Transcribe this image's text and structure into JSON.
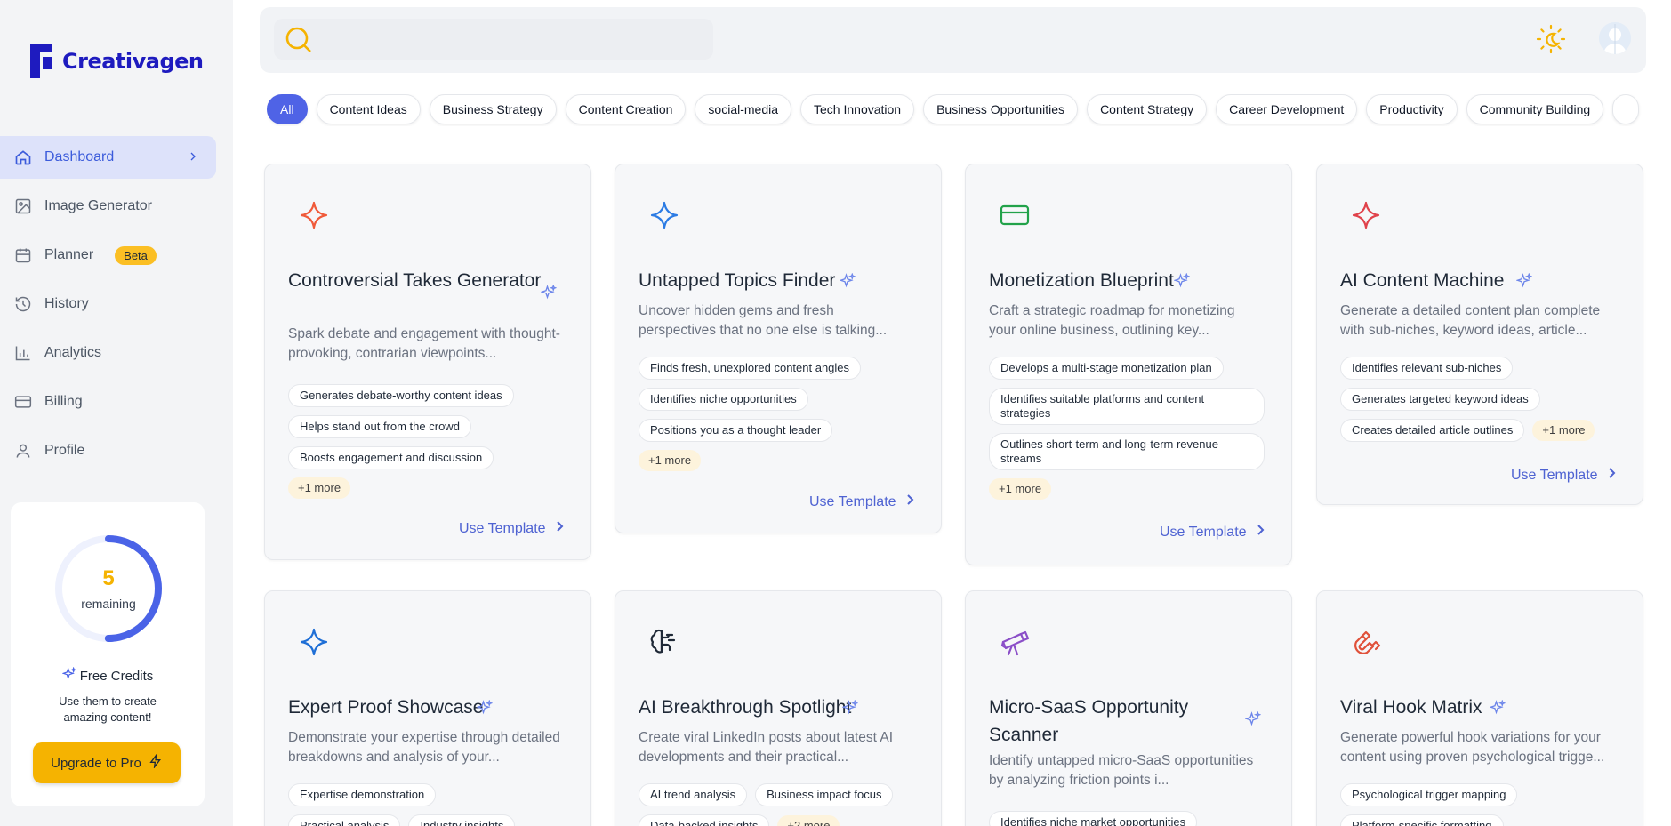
{
  "brand": {
    "name": "Creativagen"
  },
  "nav": [
    {
      "label": "Dashboard",
      "icon": "home-icon",
      "active": true
    },
    {
      "label": "Image Generator",
      "icon": "image-icon"
    },
    {
      "label": "Planner",
      "icon": "calendar-icon",
      "badge": "Beta"
    },
    {
      "label": "History",
      "icon": "history-icon"
    },
    {
      "label": "Analytics",
      "icon": "bar-chart-icon"
    },
    {
      "label": "Billing",
      "icon": "credit-card-icon"
    },
    {
      "label": "Profile",
      "icon": "user-icon"
    }
  ],
  "credits": {
    "remaining": "5",
    "remaining_label": "remaining",
    "fraction_used": 0.5,
    "title": "Free Credits",
    "description": "Use them to create amazing content!",
    "upgrade_label": "Upgrade to Pro"
  },
  "search": {
    "placeholder": ""
  },
  "categories": [
    "All",
    "Content Ideas",
    "Business Strategy",
    "Content Creation",
    "social-media",
    "Tech Innovation",
    "Business Opportunities",
    "Content Strategy",
    "Career Development",
    "Productivity",
    "Community Building"
  ],
  "active_category": "All",
  "use_template_label": "Use Template",
  "cards": [
    {
      "title": "Controversial Takes Generator",
      "description": "Spark debate and engagement with thought-provoking, contrarian viewpoints...",
      "icon": "sparkle-icon",
      "icon_color": "#f05a3a",
      "features": [
        "Generates debate-worthy content ideas",
        "Helps stand out from the crowd",
        "Boosts engagement and discussion"
      ],
      "more": "+1 more"
    },
    {
      "title": "Untapped Topics Finder",
      "description": "Uncover hidden gems and fresh perspectives that no one else is talking...",
      "icon": "sparkle-icon",
      "icon_color": "#2b7be4",
      "features": [
        "Finds fresh, unexplored content angles",
        "Identifies niche opportunities",
        "Positions you as a thought leader"
      ],
      "more": "+1 more"
    },
    {
      "title": "Monetization Blueprint",
      "description": "Craft a strategic roadmap for monetizing your online business, outlining key...",
      "icon": "credit-card-icon",
      "icon_color": "#22a24a",
      "features": [
        "Develops a multi-stage monetization plan",
        "Identifies suitable platforms and content strategies",
        "Outlines short-term and long-term revenue streams"
      ],
      "more": "+1 more"
    },
    {
      "title": "AI Content Machine",
      "description": "Generate a detailed content plan complete with sub-niches, keyword ideas, article...",
      "icon": "sparkle-icon",
      "icon_color": "#e0424b",
      "features": [
        "Identifies relevant sub-niches",
        "Generates targeted keyword ideas",
        "Creates detailed article outlines"
      ],
      "more": "+1 more"
    },
    {
      "title": "Expert Proof Showcase",
      "description": "Demonstrate your expertise through detailed breakdowns and analysis of your...",
      "icon": "sparkle-icon",
      "icon_color": "#1f6fd6",
      "features": [
        "Expertise demonstration",
        "Practical analysis",
        "Industry insights"
      ],
      "more": ""
    },
    {
      "title": "AI Breakthrough Spotlight",
      "description": "Create viral LinkedIn posts about latest AI developments and their practical...",
      "icon": "brain-icon",
      "icon_color": "#1f2937",
      "features": [
        "AI trend analysis",
        "Business impact focus",
        "Data-backed insights"
      ],
      "more": "+2 more"
    },
    {
      "title": "Micro-SaaS Opportunity Scanner",
      "description": "Identify untapped micro-SaaS opportunities by analyzing friction points i...",
      "icon": "telescope-icon",
      "icon_color": "#8b4fc8",
      "features": [
        "Identifies niche market opportunities"
      ],
      "more": ""
    },
    {
      "title": "Viral Hook Matrix",
      "description": "Generate powerful hook variations for your content using proven psychological trigge...",
      "icon": "magnet-icon",
      "icon_color": "#e0513a",
      "features": [
        "Psychological trigger mapping",
        "Platform-specific formatting"
      ],
      "more": ""
    }
  ]
}
